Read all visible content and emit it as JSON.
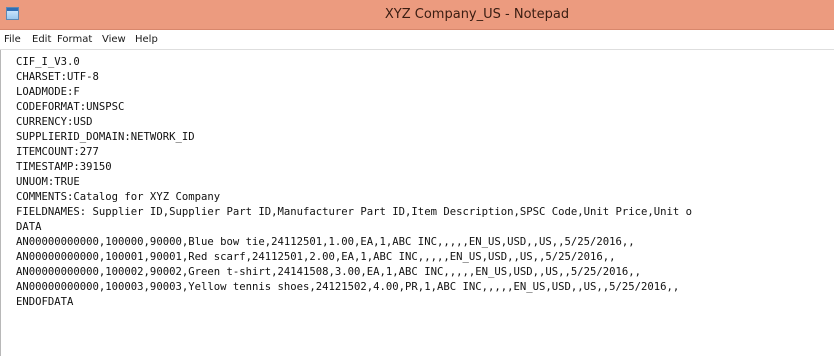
{
  "window": {
    "title": "XYZ Company_US - Notepad"
  },
  "menu": [
    "File",
    "Edit",
    "Format",
    "View",
    "Help"
  ],
  "lines": [
    "CIF_I_V3.0",
    "CHARSET:UTF-8",
    "LOADMODE:F",
    "CODEFORMAT:UNSPSC",
    "CURRENCY:USD",
    "SUPPLIERID_DOMAIN:NETWORK_ID",
    "ITEMCOUNT:277",
    "TIMESTAMP:39150",
    "UNUOM:TRUE",
    "COMMENTS:Catalog for XYZ Company",
    "FIELDNAMES: Supplier ID,Supplier Part ID,Manufacturer Part ID,Item Description,SPSC Code,Unit Price,Unit o",
    "DATA",
    "AN00000000000,100000,90000,Blue bow tie,24112501,1.00,EA,1,ABC INC,,,,,EN_US,USD,,US,,5/25/2016,,",
    "AN00000000000,100001,90001,Red scarf,24112501,2.00,EA,1,ABC INC,,,,,EN_US,USD,,US,,5/25/2016,,",
    "AN00000000000,100002,90002,Green t-shirt,24141508,3.00,EA,1,ABC INC,,,,,EN_US,USD,,US,,5/25/2016,,",
    "AN00000000000,100003,90003,Yellow tennis shoes,24121502,4.00,PR,1,ABC INC,,,,,EN_US,USD,,US,,5/25/2016,,",
    "ENDOFDATA"
  ]
}
